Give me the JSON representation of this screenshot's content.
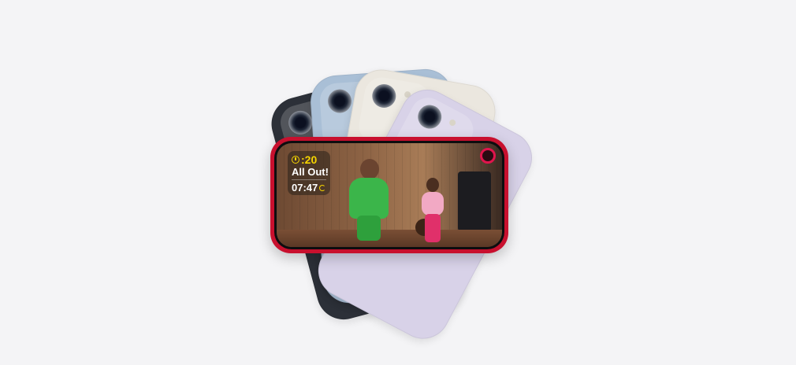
{
  "product": {
    "finishes": [
      "midnight",
      "blue",
      "starlight",
      "purple",
      "red"
    ],
    "colors": {
      "midnight": "#2c3038",
      "blue": "#a9bfd6",
      "starlight": "#ebe7df",
      "purple": "#d8d2e8",
      "red": "#c8102e"
    }
  },
  "screen": {
    "workout_overlay": {
      "interval_time": ":20",
      "interval_label": "All Out!",
      "elapsed_time": "07:47",
      "icons": [
        "timer-icon",
        "progress-ring-icon"
      ]
    },
    "activity_ring_icon": "activity-ring-icon",
    "accent_color": "#f5d400"
  }
}
